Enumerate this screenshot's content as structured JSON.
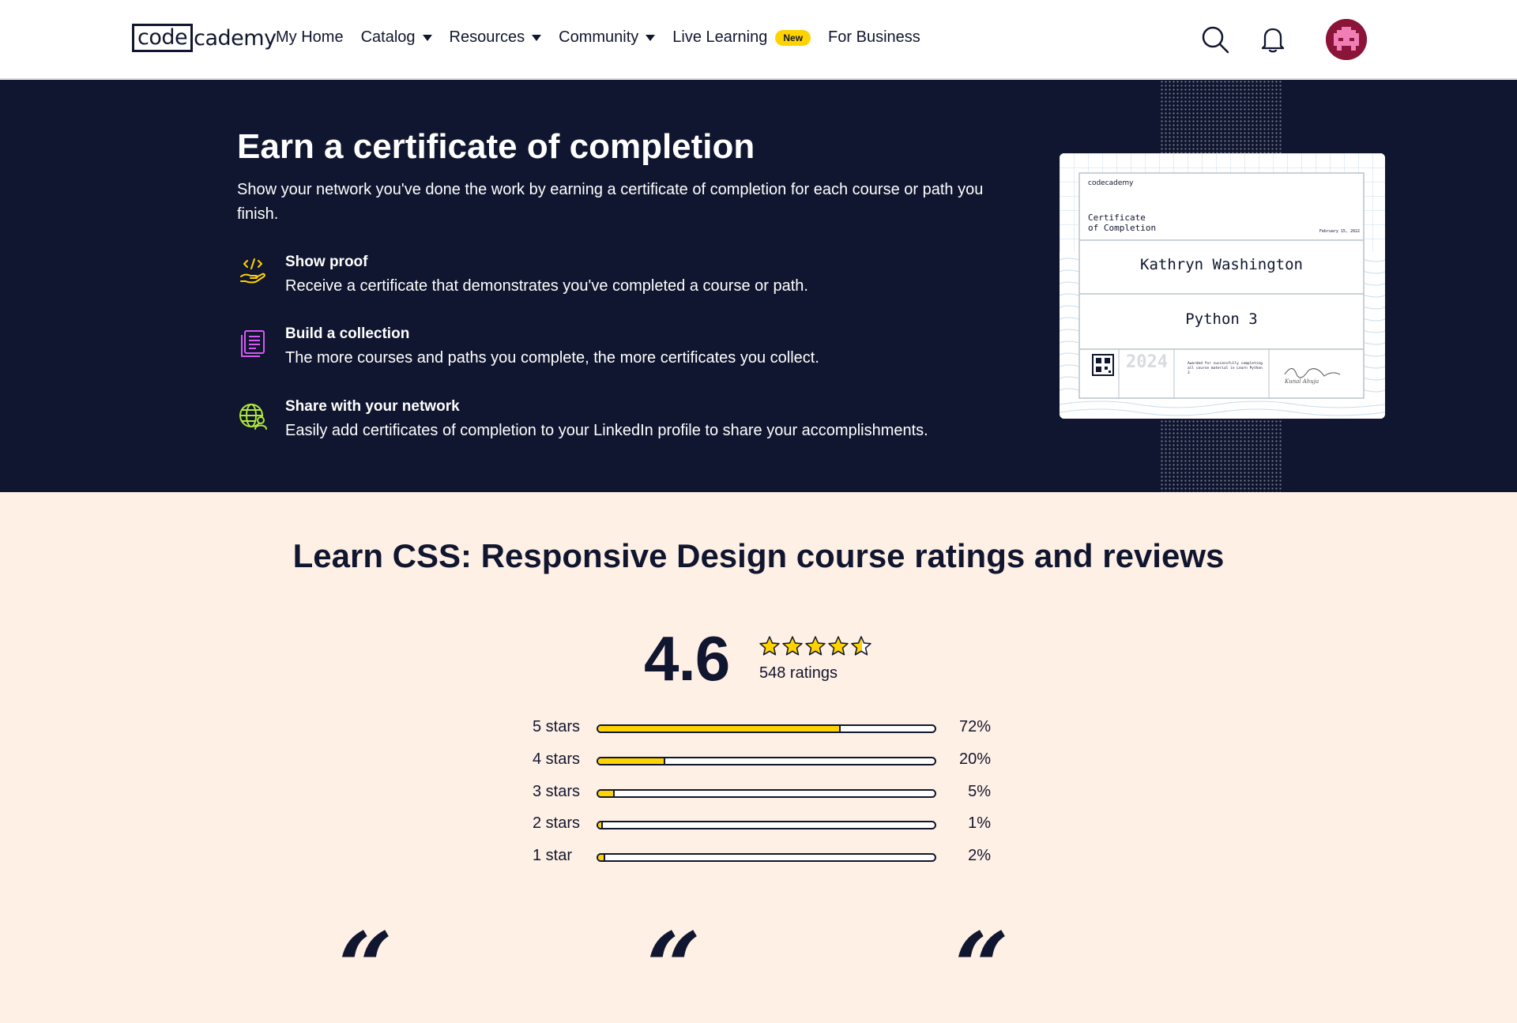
{
  "nav": {
    "logo_box": "code",
    "logo_rest": "cademy",
    "links": [
      {
        "label": "My Home",
        "dropdown": false
      },
      {
        "label": "Catalog",
        "dropdown": true
      },
      {
        "label": "Resources",
        "dropdown": true
      },
      {
        "label": "Community",
        "dropdown": true
      },
      {
        "label": "Live Learning",
        "dropdown": false,
        "badge": "New"
      },
      {
        "label": "For Business",
        "dropdown": false
      }
    ],
    "icons": [
      "search-icon",
      "bell-icon"
    ],
    "avatar": "user-avatar"
  },
  "hero": {
    "title": "Earn a certificate of completion",
    "description": "Show your network you've done the work by earning a certificate of completion for each course or path you finish.",
    "features": [
      {
        "title": "Show proof",
        "description": "Receive a certificate that demonstrates you've completed a course or path.",
        "icon": "code-hand-icon",
        "color": "#ffd300"
      },
      {
        "title": "Build a collection",
        "description": "The more courses and paths you complete, the more certificates you collect.",
        "icon": "document-stack-icon",
        "color": "#d657f2"
      },
      {
        "title": "Share with your network",
        "description": "Easily add certificates of completion to your LinkedIn profile to share your accomplishments.",
        "icon": "globe-person-icon",
        "color": "#aee938"
      }
    ],
    "certificate": {
      "logo": "codecademy",
      "heading_line1": "Certificate",
      "heading_line2": "of Completion",
      "date": "February 15, 2022",
      "name": "Kathryn Washington",
      "course": "Python 3",
      "year": "2024",
      "awarded_text": "Awarded for successfully completing all course material in Learn Python 3",
      "signature": "Kunal Ahuja"
    }
  },
  "ratings": {
    "title": "Learn CSS: Responsive Design course ratings and reviews",
    "score": "4.6",
    "score_value": 4.6,
    "count_label": "548 ratings",
    "breakdown": [
      {
        "label": "5 stars",
        "percent": 72,
        "percent_label": "72%"
      },
      {
        "label": "4 stars",
        "percent": 20,
        "percent_label": "20%"
      },
      {
        "label": "3 stars",
        "percent": 5,
        "percent_label": "5%"
      },
      {
        "label": "2 stars",
        "percent": 1,
        "percent_label": "1%"
      },
      {
        "label": "1 star",
        "percent": 2,
        "percent_label": "2%"
      }
    ],
    "quote_glyph": "“"
  },
  "colors": {
    "navy": "#10162f",
    "yellow": "#ffd300",
    "cream": "#fff0e5",
    "avatar": "#8a1538"
  }
}
